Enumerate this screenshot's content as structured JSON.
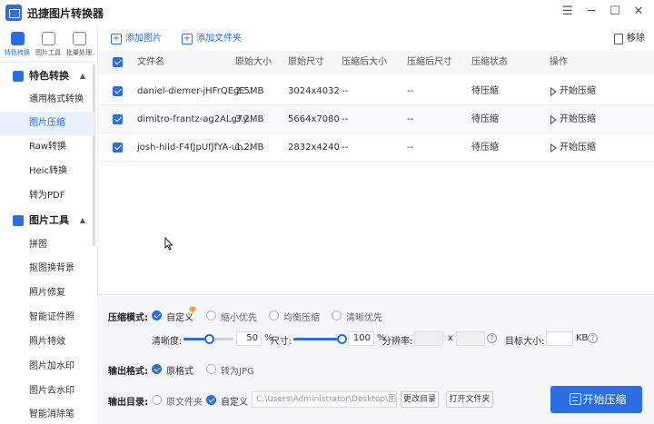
{
  "app": {
    "title": "迅捷图片转换器"
  },
  "window": {
    "menu": "☰",
    "minimize": "─",
    "maximize": "☐",
    "close": "✕"
  },
  "topnav": [
    {
      "label": "特色转换",
      "color": "#2a6ee6"
    },
    {
      "label": "图片工具",
      "color": "#7a8597"
    },
    {
      "label": "批量处理",
      "color": "#7a8597"
    }
  ],
  "sidebar": {
    "groups": [
      {
        "label": "特色转换",
        "caret": "▲",
        "items": [
          "通用格式转换",
          "图片压缩",
          "Raw转换",
          "Heic转换",
          "转为PDF"
        ]
      },
      {
        "label": "图片工具",
        "caret": "▲",
        "items": [
          "拼图",
          "抠图换背景",
          "照片修复",
          "智能证件照",
          "照片特效",
          "图片加水印",
          "图片去水印",
          "智能消除笔"
        ]
      }
    ],
    "active": "图片压缩"
  },
  "toolbar": {
    "add_image": "添加图片",
    "add_folder": "添加文件夹",
    "remove": "移除"
  },
  "table": {
    "headers": [
      "文件名",
      "原始大小",
      "原始尺寸",
      "压缩后大小",
      "压缩后尺寸",
      "压缩状态",
      "操作"
    ],
    "rows": [
      {
        "name": "daniel-diemer-jHFrQEgE...",
        "size": "2.5MB",
        "dims": "3024x4032",
        "new_size": "--",
        "new_dims": "--",
        "status": "待压缩",
        "action": "开始压缩"
      },
      {
        "name": "dimitro-frantz-ag2ALg7y...",
        "size": "3.2MB",
        "dims": "5664x7080",
        "new_size": "--",
        "new_dims": "--",
        "status": "待压缩",
        "action": "开始压缩"
      },
      {
        "name": "josh-hild-F4fJpUfJfYA-un...",
        "size": "1.2MB",
        "dims": "2832x4240",
        "new_size": "--",
        "new_dims": "--",
        "status": "待压缩",
        "action": "开始压缩"
      }
    ]
  },
  "settings": {
    "mode_label": "压缩模式:",
    "modes": [
      "自定义",
      "缩小优先",
      "均衡压缩",
      "清晰优先"
    ],
    "clarity_label": "清晰度:",
    "clarity_value": "50",
    "clarity_fraction": 0.5,
    "percent": "%",
    "size_label": "尺寸:",
    "size_value": "100",
    "size_fraction": 1.0,
    "resolution_label": "分辨率:",
    "x_sep": "x",
    "target_label": "目标大小:",
    "kb": "KB",
    "help": "?",
    "format_label": "输出格式:",
    "formats": [
      "原格式",
      "转为JPG"
    ],
    "dir_label": "输出目录:",
    "dirs": [
      "原文件夹",
      "自定义"
    ],
    "path": "C:\\Users\\Administrator\\Desktop\\图片",
    "change_dir": "更改目录",
    "open_folder": "打开文件夹",
    "start": "开始压缩"
  }
}
